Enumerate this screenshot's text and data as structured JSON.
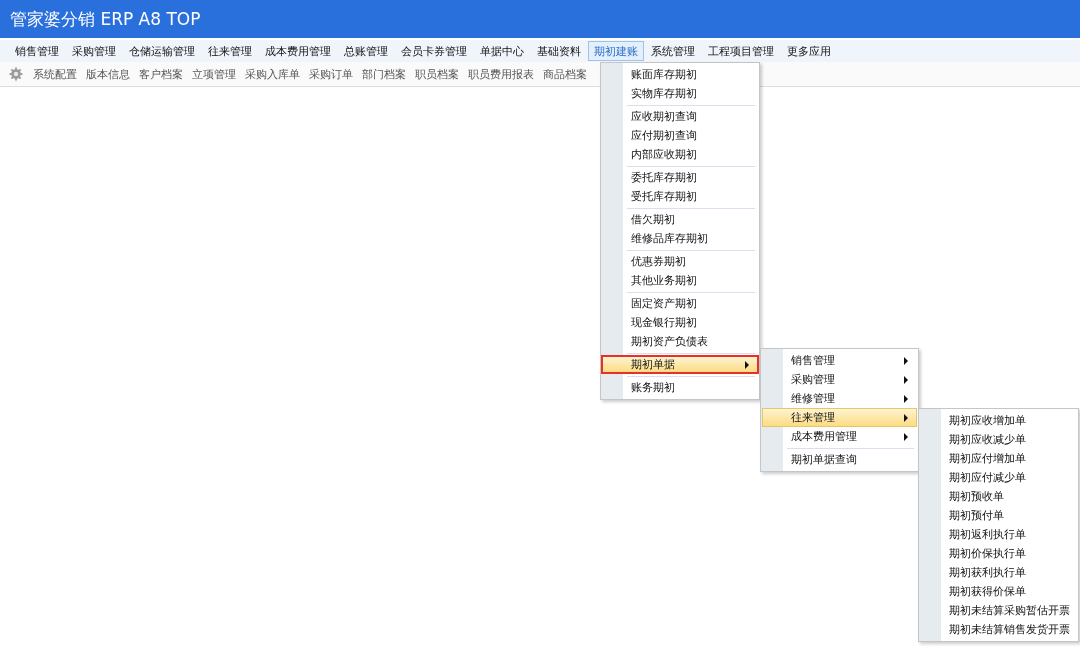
{
  "app_title": "管家婆分销 ERP A8 TOP",
  "nav": [
    {
      "label": "销售管理",
      "selected": false
    },
    {
      "label": "采购管理",
      "selected": false
    },
    {
      "label": "仓储运输管理",
      "selected": false
    },
    {
      "label": "往来管理",
      "selected": false
    },
    {
      "label": "成本费用管理",
      "selected": false
    },
    {
      "label": "总账管理",
      "selected": false
    },
    {
      "label": "会员卡券管理",
      "selected": false
    },
    {
      "label": "单据中心",
      "selected": false
    },
    {
      "label": "基础资料",
      "selected": false
    },
    {
      "label": "期初建账",
      "selected": true
    },
    {
      "label": "系统管理",
      "selected": false
    },
    {
      "label": "工程项目管理",
      "selected": false
    },
    {
      "label": "更多应用",
      "selected": false
    }
  ],
  "shortcuts": [
    "系统配置",
    "版本信息",
    "客户档案",
    "立项管理",
    "采购入库单",
    "采购订单",
    "部门档案",
    "职员档案",
    "职员费用报表",
    "商品档案"
  ],
  "menu": {
    "groups": [
      [
        {
          "label": "账面库存期初",
          "selected": false,
          "has_submenu": false,
          "outlined": false
        },
        {
          "label": "实物库存期初",
          "selected": false,
          "has_submenu": false,
          "outlined": false
        }
      ],
      [
        {
          "label": "应收期初查询",
          "selected": false,
          "has_submenu": false,
          "outlined": false
        },
        {
          "label": "应付期初查询",
          "selected": false,
          "has_submenu": false,
          "outlined": false
        },
        {
          "label": "内部应收期初",
          "selected": false,
          "has_submenu": false,
          "outlined": false
        }
      ],
      [
        {
          "label": "委托库存期初",
          "selected": false,
          "has_submenu": false,
          "outlined": false
        },
        {
          "label": "受托库存期初",
          "selected": false,
          "has_submenu": false,
          "outlined": false
        }
      ],
      [
        {
          "label": "借欠期初",
          "selected": false,
          "has_submenu": false,
          "outlined": false
        },
        {
          "label": "维修品库存期初",
          "selected": false,
          "has_submenu": false,
          "outlined": false
        }
      ],
      [
        {
          "label": "优惠券期初",
          "selected": false,
          "has_submenu": false,
          "outlined": false
        },
        {
          "label": "其他业务期初",
          "selected": false,
          "has_submenu": false,
          "outlined": false
        }
      ],
      [
        {
          "label": "固定资产期初",
          "selected": false,
          "has_submenu": false,
          "outlined": false
        },
        {
          "label": "现金银行期初",
          "selected": false,
          "has_submenu": false,
          "outlined": false
        },
        {
          "label": "期初资产负债表",
          "selected": false,
          "has_submenu": false,
          "outlined": false
        }
      ],
      [
        {
          "label": "期初单据",
          "selected": true,
          "has_submenu": true,
          "outlined": true
        }
      ],
      [
        {
          "label": "账务期初",
          "selected": false,
          "has_submenu": false,
          "outlined": false
        }
      ]
    ]
  },
  "submenu": {
    "groups": [
      [
        {
          "label": "销售管理",
          "selected": false,
          "has_submenu": true,
          "outlined": false
        },
        {
          "label": "采购管理",
          "selected": false,
          "has_submenu": true,
          "outlined": false
        },
        {
          "label": "维修管理",
          "selected": false,
          "has_submenu": true,
          "outlined": false
        },
        {
          "label": "往来管理",
          "selected": true,
          "has_submenu": true,
          "outlined": false
        },
        {
          "label": "成本费用管理",
          "selected": false,
          "has_submenu": true,
          "outlined": false
        }
      ],
      [
        {
          "label": "期初单据查询",
          "selected": false,
          "has_submenu": false,
          "outlined": false
        }
      ]
    ]
  },
  "submenu2": {
    "groups": [
      [
        {
          "label": "期初应收增加单",
          "selected": false,
          "has_submenu": false,
          "outlined": false
        },
        {
          "label": "期初应收减少单",
          "selected": false,
          "has_submenu": false,
          "outlined": false
        },
        {
          "label": "期初应付增加单",
          "selected": false,
          "has_submenu": false,
          "outlined": false
        },
        {
          "label": "期初应付减少单",
          "selected": false,
          "has_submenu": false,
          "outlined": false
        },
        {
          "label": "期初预收单",
          "selected": false,
          "has_submenu": false,
          "outlined": false
        },
        {
          "label": "期初预付单",
          "selected": false,
          "has_submenu": false,
          "outlined": false
        },
        {
          "label": "期初返利执行单",
          "selected": false,
          "has_submenu": false,
          "outlined": false
        },
        {
          "label": "期初价保执行单",
          "selected": false,
          "has_submenu": false,
          "outlined": false
        },
        {
          "label": "期初获利执行单",
          "selected": false,
          "has_submenu": false,
          "outlined": false
        },
        {
          "label": "期初获得价保单",
          "selected": false,
          "has_submenu": false,
          "outlined": false
        },
        {
          "label": "期初未结算采购暂估开票",
          "selected": false,
          "has_submenu": false,
          "outlined": false
        },
        {
          "label": "期初未结算销售发货开票",
          "selected": false,
          "has_submenu": false,
          "outlined": false
        }
      ]
    ]
  }
}
